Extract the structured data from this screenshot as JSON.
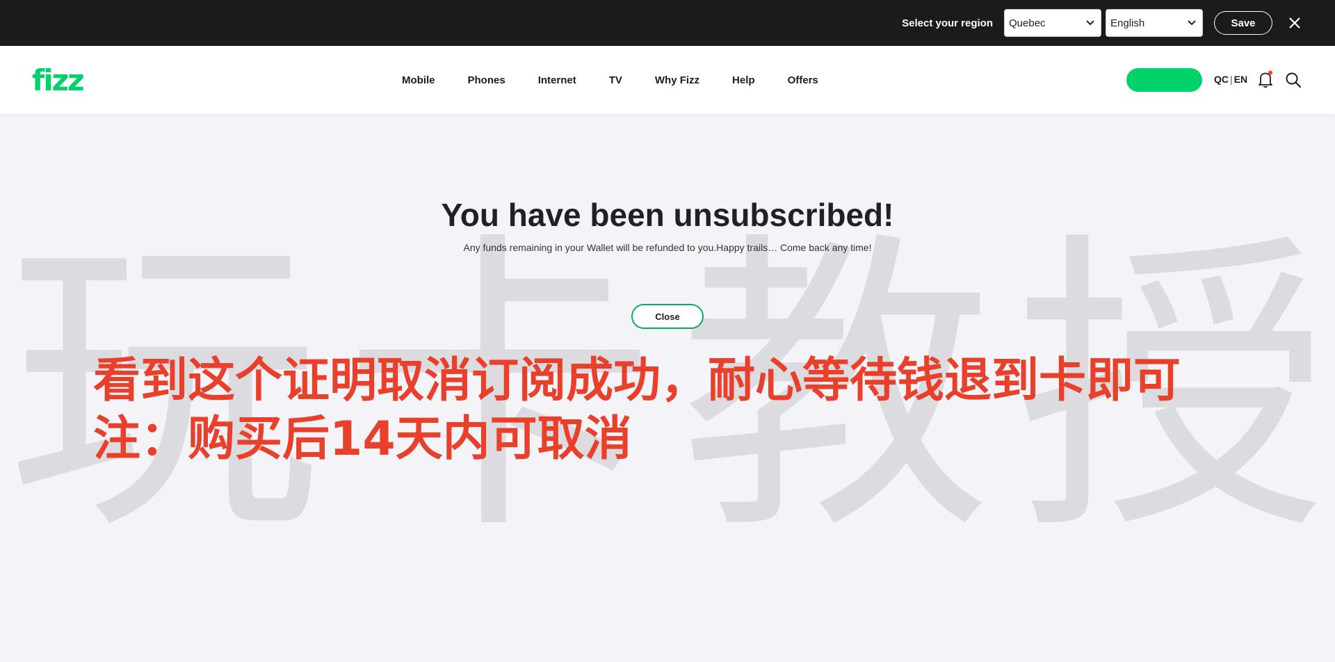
{
  "region_bar": {
    "label": "Select your region",
    "region_value": "Quebec",
    "language_value": "English",
    "save_label": "Save"
  },
  "header": {
    "logo": "fizz",
    "nav": [
      "Mobile",
      "Phones",
      "Internet",
      "TV",
      "Why Fizz",
      "Help",
      "Offers"
    ],
    "lang_qc": "QC",
    "lang_sep": "|",
    "lang_en": "EN"
  },
  "main": {
    "title": "You have been unsubscribed!",
    "subtitle": "Any funds remaining in your Wallet will be refunded to you.Happy trails… Come back any time!",
    "close_label": "Close"
  },
  "overlay": {
    "line1": "看到这个证明取消订阅成功，耐心等待钱退到卡即可",
    "line2": "注：购买后14天内可取消"
  },
  "watermark": {
    "chars": [
      "玩",
      "卡",
      "教",
      "授"
    ]
  },
  "colors": {
    "brand_green": "#00d26a",
    "overlay_red": "#e8402a",
    "top_bar": "#1b1b1b"
  }
}
